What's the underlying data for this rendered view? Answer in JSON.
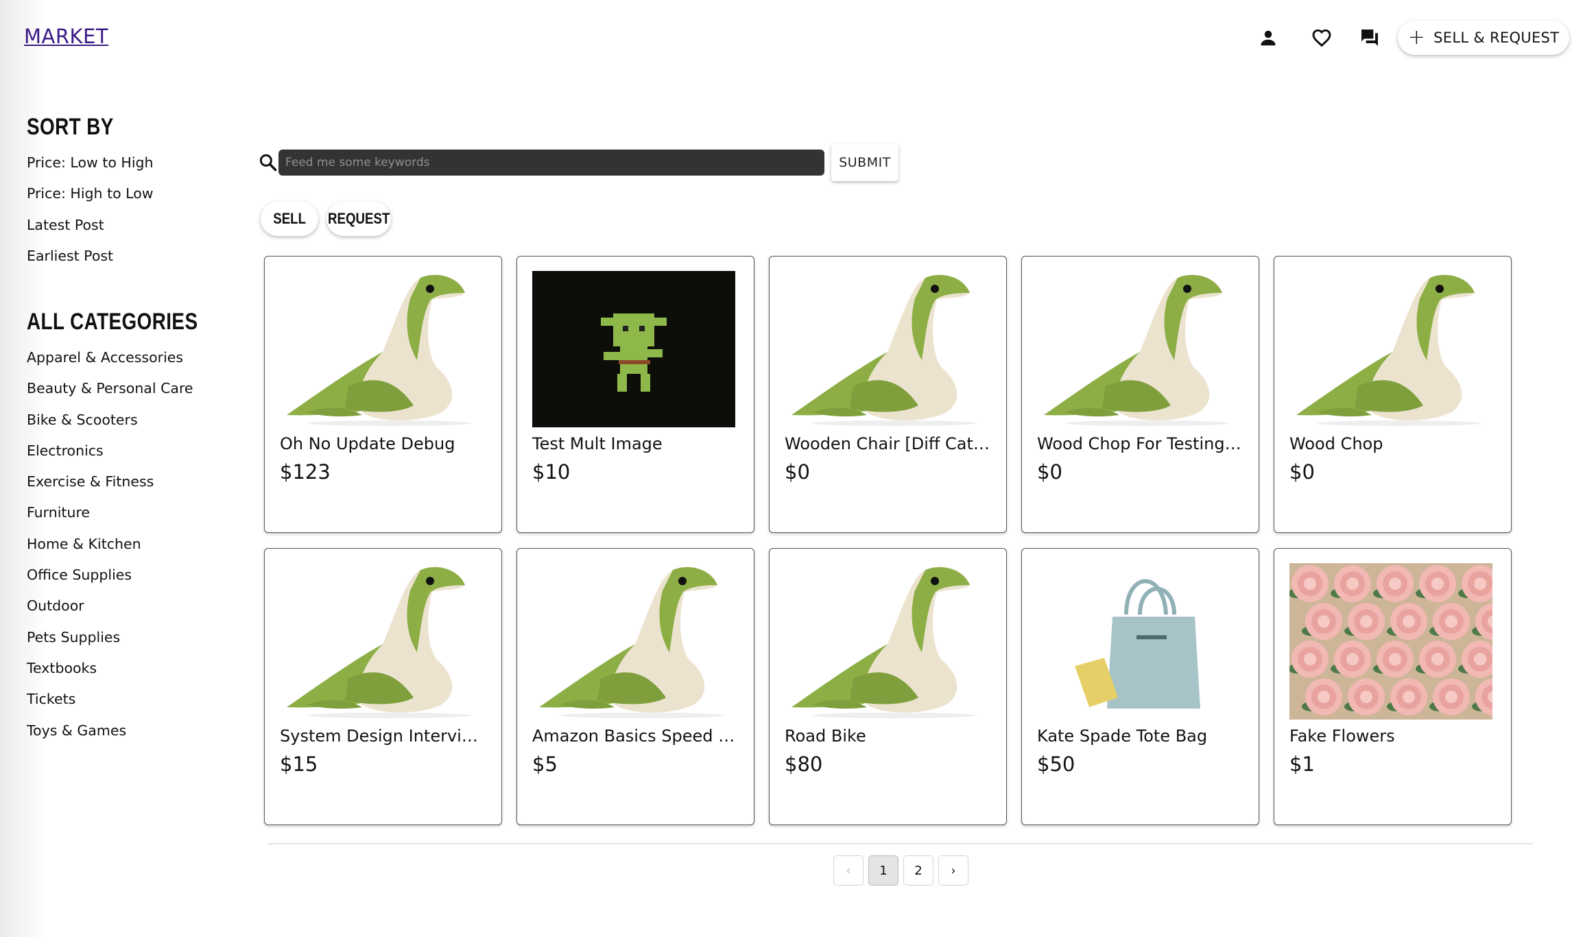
{
  "header": {
    "logo": "MARKET",
    "icons": [
      "person-icon",
      "heart-icon",
      "chat-icon"
    ],
    "sell_request_plus": "+",
    "sell_request_label": "SELL & REQUEST"
  },
  "sidebar": {
    "sort_heading": "SORT BY",
    "sort_options": [
      "Price: Low to High",
      "Price: High to Low",
      "Latest Post",
      "Earliest Post"
    ],
    "categories_heading": "ALL CATEGORIES",
    "categories": [
      "Apparel & Accessories",
      "Beauty & Personal Care",
      "Bike & Scooters",
      "Electronics",
      "Exercise & Fitness",
      "Furniture",
      "Home & Kitchen",
      "Office Supplies",
      "Outdoor",
      "Pets Supplies",
      "Textbooks",
      "Tickets",
      "Toys & Games"
    ]
  },
  "search": {
    "placeholder": "Feed me some keywords",
    "submit_label": "SUBMIT"
  },
  "tabs": {
    "sell": "SELL",
    "request": "REQUEST"
  },
  "listings": [
    {
      "title": "Oh No Update Debug",
      "price": "$123",
      "image": "plush"
    },
    {
      "title": "Test Mult Image",
      "price": "$10",
      "image": "pixel"
    },
    {
      "title": "Wooden Chair [Diff Categ...",
      "price": "$0",
      "image": "plush"
    },
    {
      "title": "Wood Chop For Testing ...",
      "price": "$0",
      "image": "plush"
    },
    {
      "title": "Wood Chop",
      "price": "$0",
      "image": "plush"
    },
    {
      "title": "System Design Interview ...",
      "price": "$15",
      "image": "plush"
    },
    {
      "title": "Amazon Basics Speed S...",
      "price": "$5",
      "image": "plush"
    },
    {
      "title": "Road Bike",
      "price": "$80",
      "image": "plush"
    },
    {
      "title": "Kate Spade Tote Bag",
      "price": "$50",
      "image": "bag"
    },
    {
      "title": "Fake Flowers",
      "price": "$1",
      "image": "flowers"
    }
  ],
  "pagination": {
    "prev": "‹",
    "pages": [
      "1",
      "2"
    ],
    "current": "1",
    "next": "›"
  }
}
